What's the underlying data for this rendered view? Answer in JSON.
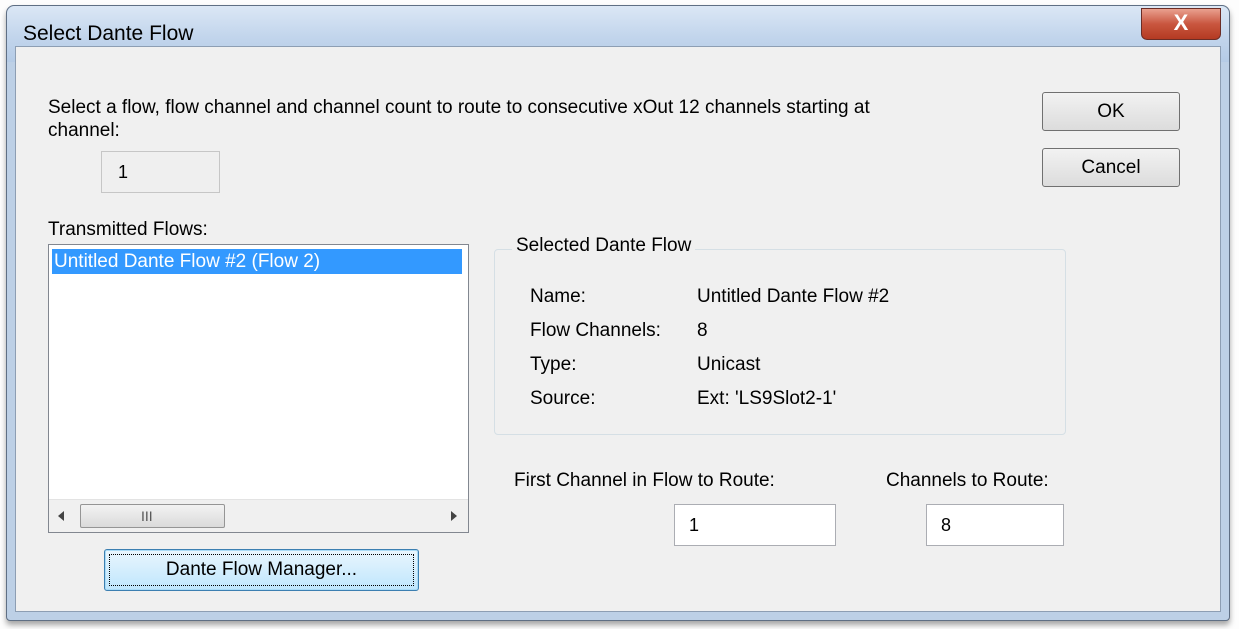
{
  "window": {
    "title": "Select Dante Flow",
    "close_label": "X"
  },
  "instruction": {
    "line1": "Select a flow, flow channel and channel count to route to consecutive xOut 12 channels starting at",
    "line2": "channel:"
  },
  "start_channel": {
    "value": "1"
  },
  "buttons": {
    "ok": "OK",
    "cancel": "Cancel",
    "flow_manager": "Dante Flow Manager..."
  },
  "transmitted_flows": {
    "label": "Transmitted Flows:",
    "items": [
      {
        "label": "Untitled Dante Flow #2 (Flow 2)",
        "selected": true
      }
    ],
    "scrollbar_grip": "III"
  },
  "selected_flow": {
    "legend": "Selected Dante Flow",
    "fields": [
      {
        "label": "Name:",
        "value": "Untitled Dante Flow #2"
      },
      {
        "label": "Flow Channels:",
        "value": "8"
      },
      {
        "label": "Type:",
        "value": "Unicast"
      },
      {
        "label": "Source:",
        "value": "Ext: 'LS9Slot2-1'"
      }
    ]
  },
  "routing": {
    "first_channel_label": "First Channel in Flow to Route:",
    "first_channel_value": "1",
    "channels_label": "Channels to Route:",
    "channels_value": "8"
  },
  "colors": {
    "selection": "#3399ff",
    "close_button": "#c9563f",
    "frame": "#bdd0e6"
  }
}
